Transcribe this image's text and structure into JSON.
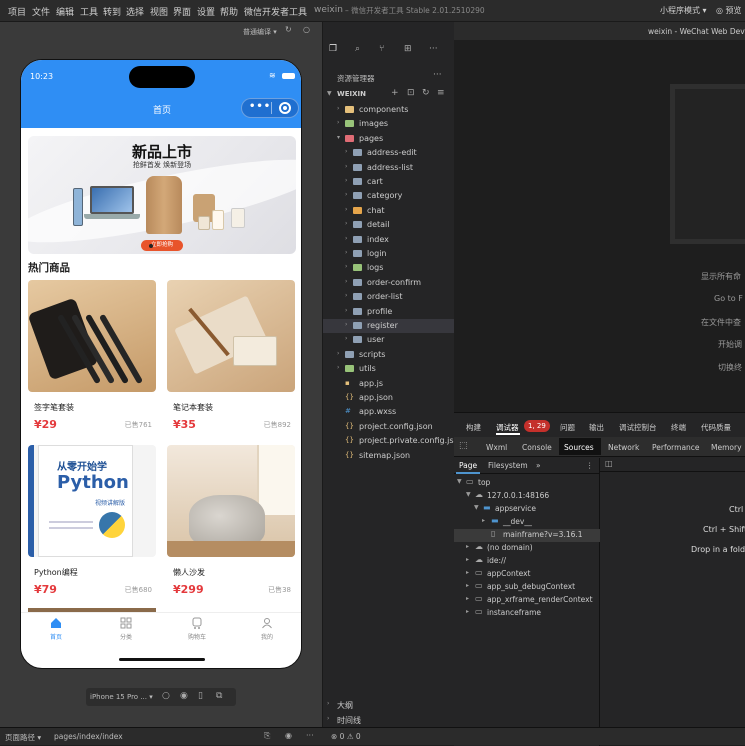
{
  "menubar": {
    "items": [
      "项目",
      "文件",
      "编辑",
      "工具",
      "转到",
      "选择",
      "视图",
      "界面",
      "设置",
      "帮助",
      "微信开发者工具"
    ],
    "project": "weixin",
    "title": "– 微信开发者工具 Stable 2.01.2510290",
    "mode": "小程序模式 ▾",
    "preview": "预览"
  },
  "simulator": {
    "compile_label": "普通编译 ▾",
    "device": "iPhone 15 Pro ... ▾"
  },
  "phone": {
    "time": "10:23",
    "nav_title": "首页",
    "banner_title": "新品上市",
    "banner_subtitle": "抢鲜首发 焕新登场",
    "banner_button": "立即抢购",
    "section_title": "热门商品",
    "products": [
      {
        "name": "签字笔套装",
        "price": "¥29",
        "sold": "已售761"
      },
      {
        "name": "笔记本套装",
        "price": "¥35",
        "sold": "已售892"
      },
      {
        "name": "Python编程",
        "price": "¥79",
        "sold": "已售680"
      },
      {
        "name": "懒人沙发",
        "price": "¥299",
        "sold": "已售38"
      }
    ],
    "book_cover": {
      "line1": "从零开始学",
      "line2": "Python",
      "line3": "视频讲解版"
    },
    "tabs": [
      {
        "label": "首页",
        "icon": "home-icon"
      },
      {
        "label": "分类",
        "icon": "grid-icon"
      },
      {
        "label": "购物车",
        "icon": "cart-icon"
      },
      {
        "label": "我的",
        "icon": "user-icon"
      }
    ]
  },
  "explorer": {
    "header": "资源管理器",
    "root": "WEIXIN",
    "tree": [
      {
        "label": "components",
        "indent": 1,
        "type": "folder",
        "open": false
      },
      {
        "label": "images",
        "indent": 1,
        "type": "folder",
        "open": false
      },
      {
        "label": "pages",
        "indent": 1,
        "type": "folder",
        "open": true
      },
      {
        "label": "address-edit",
        "indent": 2,
        "type": "folder",
        "open": false
      },
      {
        "label": "address-list",
        "indent": 2,
        "type": "folder",
        "open": false
      },
      {
        "label": "cart",
        "indent": 2,
        "type": "folder",
        "open": false
      },
      {
        "label": "category",
        "indent": 2,
        "type": "folder",
        "open": false
      },
      {
        "label": "chat",
        "indent": 2,
        "type": "folder",
        "open": false
      },
      {
        "label": "detail",
        "indent": 2,
        "type": "folder",
        "open": false
      },
      {
        "label": "index",
        "indent": 2,
        "type": "folder",
        "open": false
      },
      {
        "label": "login",
        "indent": 2,
        "type": "folder",
        "open": false
      },
      {
        "label": "logs",
        "indent": 2,
        "type": "folder",
        "open": false
      },
      {
        "label": "order-confirm",
        "indent": 2,
        "type": "folder",
        "open": false
      },
      {
        "label": "order-list",
        "indent": 2,
        "type": "folder",
        "open": false
      },
      {
        "label": "profile",
        "indent": 2,
        "type": "folder",
        "open": false
      },
      {
        "label": "register",
        "indent": 2,
        "type": "folder",
        "open": false
      },
      {
        "label": "user",
        "indent": 2,
        "type": "folder",
        "open": false
      },
      {
        "label": "scripts",
        "indent": 1,
        "type": "folder",
        "open": false
      },
      {
        "label": "utils",
        "indent": 1,
        "type": "folder",
        "open": false
      },
      {
        "label": "app.js",
        "indent": 1,
        "type": "js"
      },
      {
        "label": "app.json",
        "indent": 1,
        "type": "json"
      },
      {
        "label": "app.wxss",
        "indent": 1,
        "type": "wxss"
      },
      {
        "label": "project.config.json",
        "indent": 1,
        "type": "json"
      },
      {
        "label": "project.private.config.js...",
        "indent": 1,
        "type": "json"
      },
      {
        "label": "sitemap.json",
        "indent": 1,
        "type": "json"
      }
    ],
    "outline": "大纲",
    "timeline": "时间线"
  },
  "editor": {
    "tab_title": "weixin - WeChat Web Devtools",
    "hints": [
      "显示所有命",
      "Go to F",
      "在文件中查",
      "开始调",
      "切换终"
    ]
  },
  "devtools": {
    "tabs": [
      "构建",
      "调试器",
      "问题",
      "输出",
      "调试控制台",
      "终端",
      "代码质量"
    ],
    "badge": "1, 29",
    "subtabs": [
      "Wxml",
      "Console",
      "Sources",
      "Network",
      "Performance",
      "Memory"
    ],
    "sources_tabs": [
      "Page",
      "Filesystem"
    ],
    "tree": [
      {
        "label": "top",
        "level": 0
      },
      {
        "label": "127.0.0.1:48166",
        "level": 1
      },
      {
        "label": "appservice",
        "level": 2
      },
      {
        "label": "__dev__",
        "level": 3
      },
      {
        "label": "mainframe?v=3.16.1",
        "level": 3
      },
      {
        "label": "(no domain)",
        "level": 1
      },
      {
        "label": "ide://",
        "level": 1
      },
      {
        "label": "appContext",
        "level": 1
      },
      {
        "label": "app_sub_debugContext",
        "level": 1
      },
      {
        "label": "app_xrframe_renderContext",
        "level": 1
      },
      {
        "label": "instanceframe",
        "level": 1
      }
    ],
    "hints": [
      "Ctrl",
      "Ctrl + Shift",
      "Drop in a fold"
    ]
  },
  "statusbar": {
    "path_label": "页面路径 ▾",
    "path": "pages/index/index",
    "errors": "⊗ 0 ⚠ 0"
  }
}
